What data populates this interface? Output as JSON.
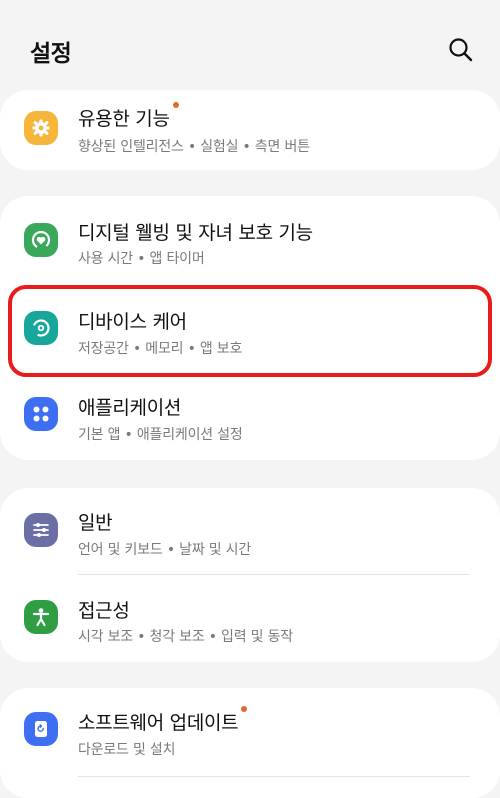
{
  "header": {
    "title": "설정",
    "search_icon": "search-icon"
  },
  "groups": [
    {
      "items": [
        {
          "id": "advanced",
          "title": "유용한 기능",
          "subtitle": "향상된 인텔리전스 • 실험실 • 측면 버튼",
          "badge": true,
          "icon": "gear-icon",
          "icon_color": "#f5b63b"
        }
      ]
    },
    {
      "items": [
        {
          "id": "digital-wellbeing",
          "title": "디지털 웰빙 및 자녀 보호 기능",
          "subtitle": "사용 시간 • 앱 타이머",
          "icon": "wellbeing-icon",
          "icon_color": "#3aa85a"
        },
        {
          "id": "device-care",
          "title": "디바이스 케어",
          "subtitle": "저장공간 • 메모리 • 앱 보호",
          "icon": "device-care-icon",
          "icon_color": "#17a79a"
        },
        {
          "id": "apps",
          "title": "애플리케이션",
          "subtitle": "기본 앱 • 애플리케이션 설정",
          "icon": "apps-grid-icon",
          "icon_color": "#3e6ff2"
        }
      ]
    },
    {
      "items": [
        {
          "id": "general",
          "title": "일반",
          "subtitle": "언어 및 키보드 • 날짜 및 시간",
          "icon": "sliders-icon",
          "icon_color": "#6b6fa6"
        },
        {
          "id": "accessibility",
          "title": "접근성",
          "subtitle": "시각 보조 • 청각 보조 • 입력 및 동작",
          "icon": "accessibility-icon",
          "icon_color": "#2f9e43"
        }
      ]
    },
    {
      "items": [
        {
          "id": "software-update",
          "title": "소프트웨어 업데이트",
          "subtitle": "다운로드 및 설치",
          "badge": true,
          "icon": "update-icon",
          "icon_color": "#3e6ff2"
        }
      ]
    }
  ],
  "colors": {
    "background": "#f4f4f4",
    "badge": "#e2682c",
    "highlight": "#ea1b1b"
  }
}
